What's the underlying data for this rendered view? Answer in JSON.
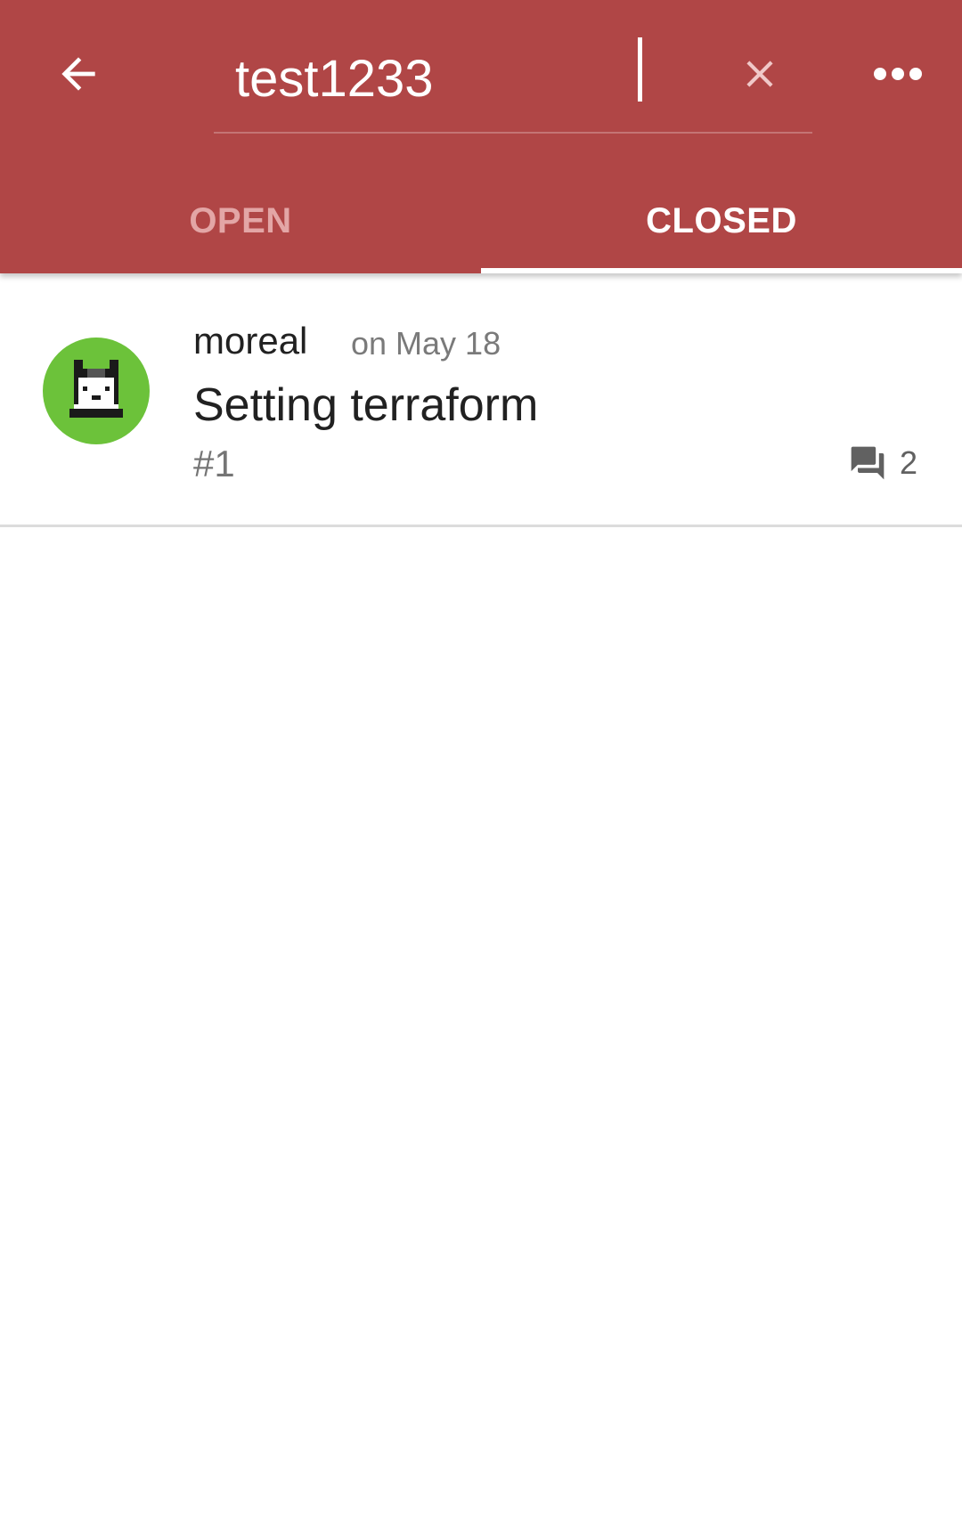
{
  "search": {
    "query": "test1233"
  },
  "icons": {
    "back": "arrow-back-icon",
    "clear": "close-icon",
    "more": "more-horizontal-icon",
    "comments": "forum-icon"
  },
  "colors": {
    "header": "#b04646",
    "avatar_bg": "#6cc23a",
    "tab_active": "#ffffff",
    "tab_inactive": "#e3a6a6"
  },
  "tabs": [
    {
      "label": "OPEN",
      "active": false
    },
    {
      "label": "CLOSED",
      "active": true
    }
  ],
  "issues": [
    {
      "author": "moreal",
      "date": "on May 18",
      "title": "Setting terraform",
      "number": "#1",
      "comments": "2"
    }
  ]
}
